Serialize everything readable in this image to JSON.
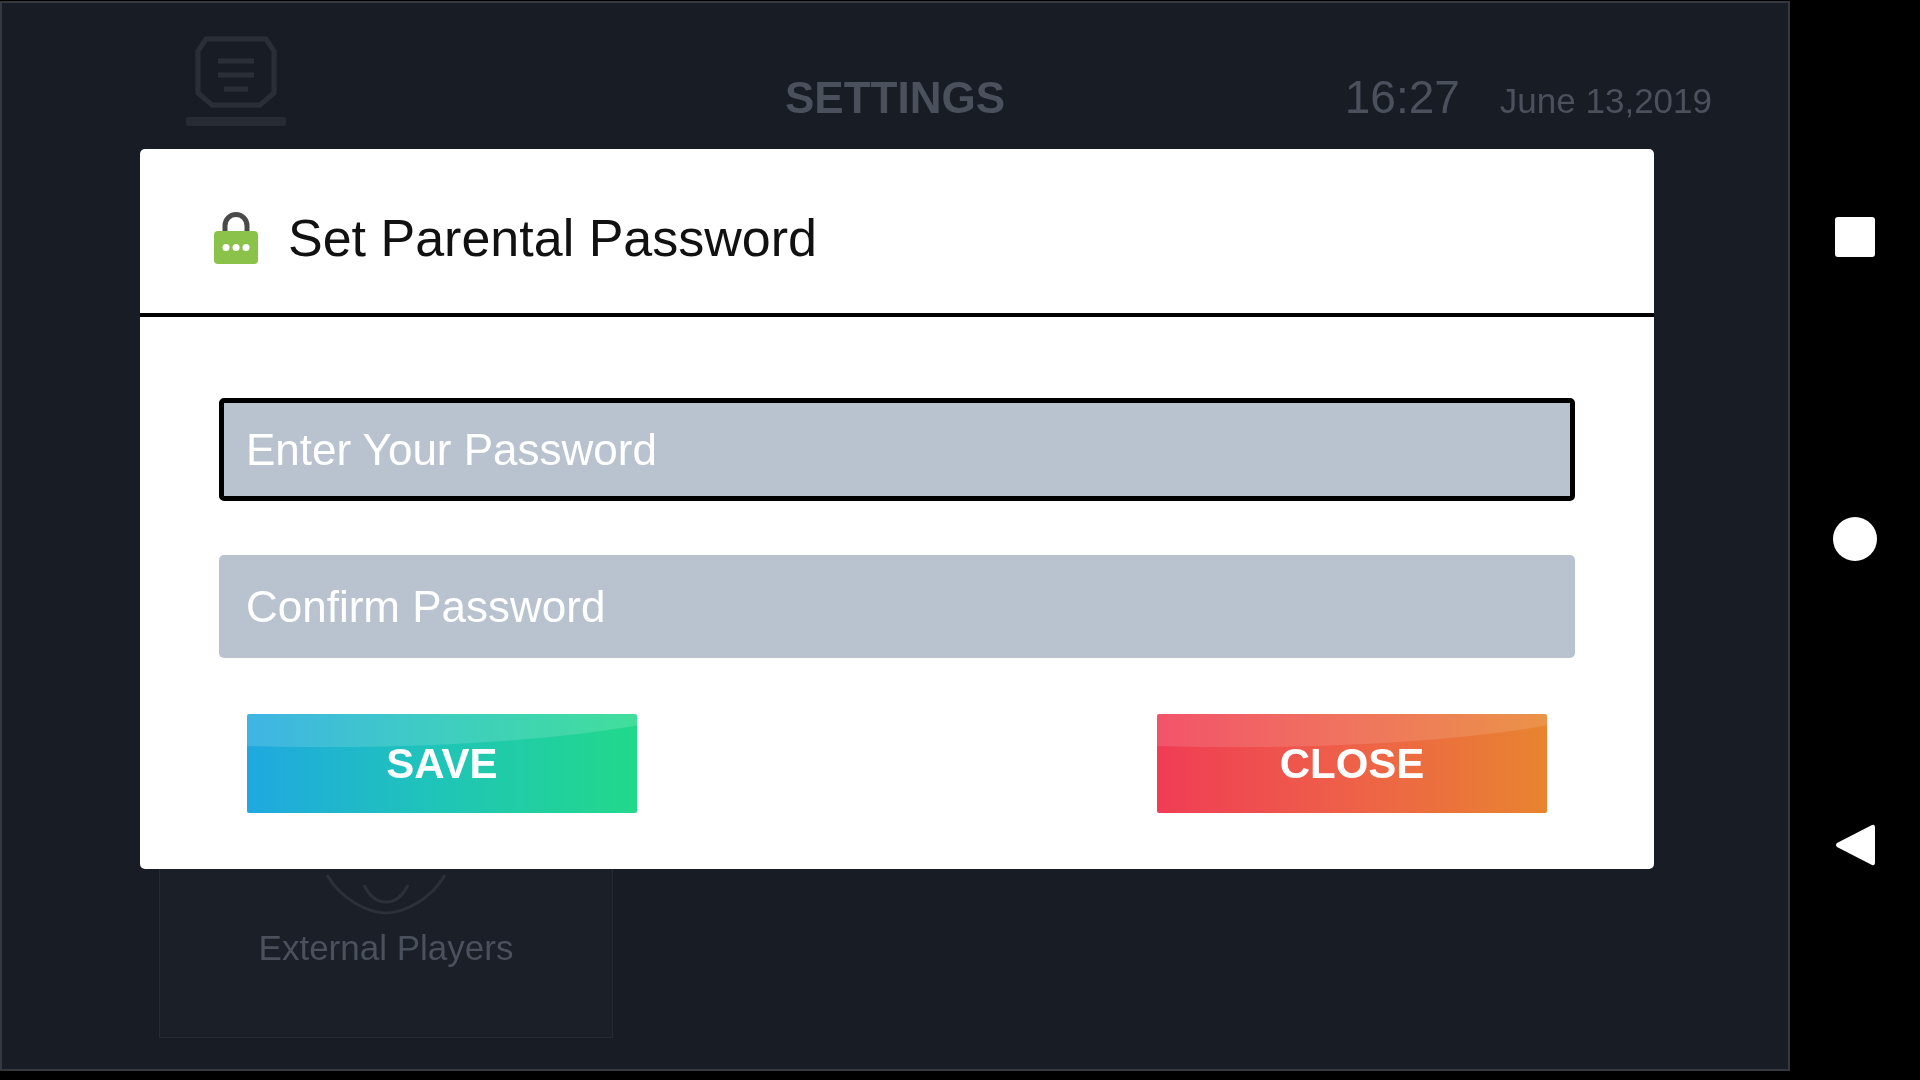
{
  "header": {
    "title": "SETTINGS",
    "time": "16:27",
    "date": "June 13,2019"
  },
  "cards": [
    {
      "label": "External Players"
    }
  ],
  "dialog": {
    "title": "Set Parental Password",
    "fields": [
      {
        "placeholder": "Enter Your Password",
        "focused": true
      },
      {
        "placeholder": "Confirm Password",
        "focused": false
      }
    ],
    "buttons": [
      {
        "label": "SAVE",
        "kind": "save"
      },
      {
        "label": "CLOSE",
        "kind": "close"
      }
    ]
  }
}
